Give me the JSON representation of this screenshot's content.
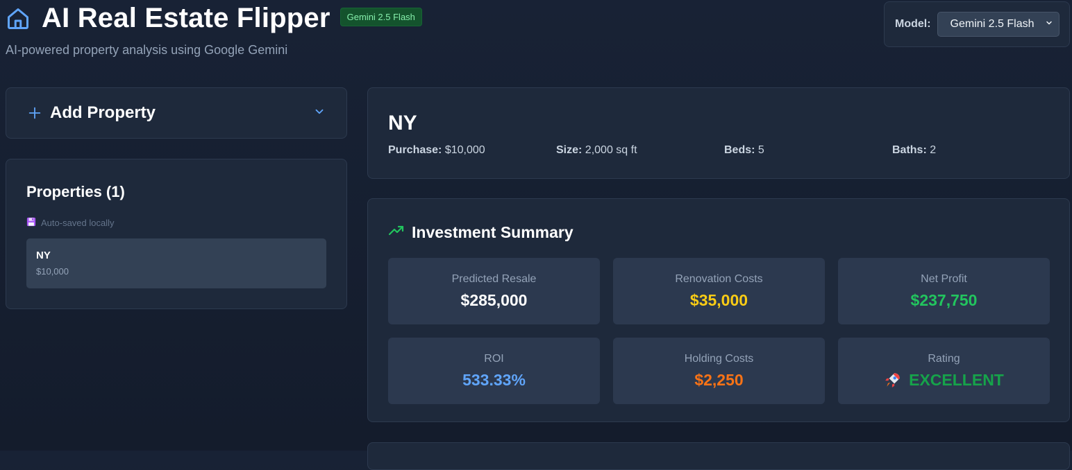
{
  "header": {
    "title": "AI Real Estate Flipper",
    "badge": "Gemini 2.5 Flash",
    "subtitle": "AI-powered property analysis using Google Gemini"
  },
  "model_selector": {
    "label": "Model:",
    "selected": "Gemini 2.5 Flash"
  },
  "add_property": {
    "label": "Add Property"
  },
  "properties": {
    "title": "Properties (1)",
    "autosave": "Auto-saved locally",
    "items": [
      {
        "name": "NY",
        "price": "$10,000"
      }
    ]
  },
  "property_detail": {
    "title": "NY",
    "fields": [
      {
        "label": "Purchase:",
        "value": "$10,000"
      },
      {
        "label": "Size:",
        "value": "2,000 sq ft"
      },
      {
        "label": "Beds:",
        "value": "5"
      },
      {
        "label": "Baths:",
        "value": "2"
      }
    ]
  },
  "summary": {
    "title": "Investment Summary",
    "metrics": [
      {
        "label": "Predicted Resale",
        "value": "$285,000",
        "color": "#ffffff"
      },
      {
        "label": "Renovation Costs",
        "value": "$35,000",
        "color": "#facc15"
      },
      {
        "label": "Net Profit",
        "value": "$237,750",
        "color": "#22c55e"
      },
      {
        "label": "ROI",
        "value": "533.33%",
        "color": "#60a5fa"
      },
      {
        "label": "Holding Costs",
        "value": "$2,250",
        "color": "#f97316"
      },
      {
        "label": "Rating",
        "value": "EXCELLENT",
        "icon": "rocket-icon",
        "color": "#16a34a"
      }
    ]
  },
  "colors": {
    "accent": "#60a5fa",
    "positive": "#22c55e"
  }
}
